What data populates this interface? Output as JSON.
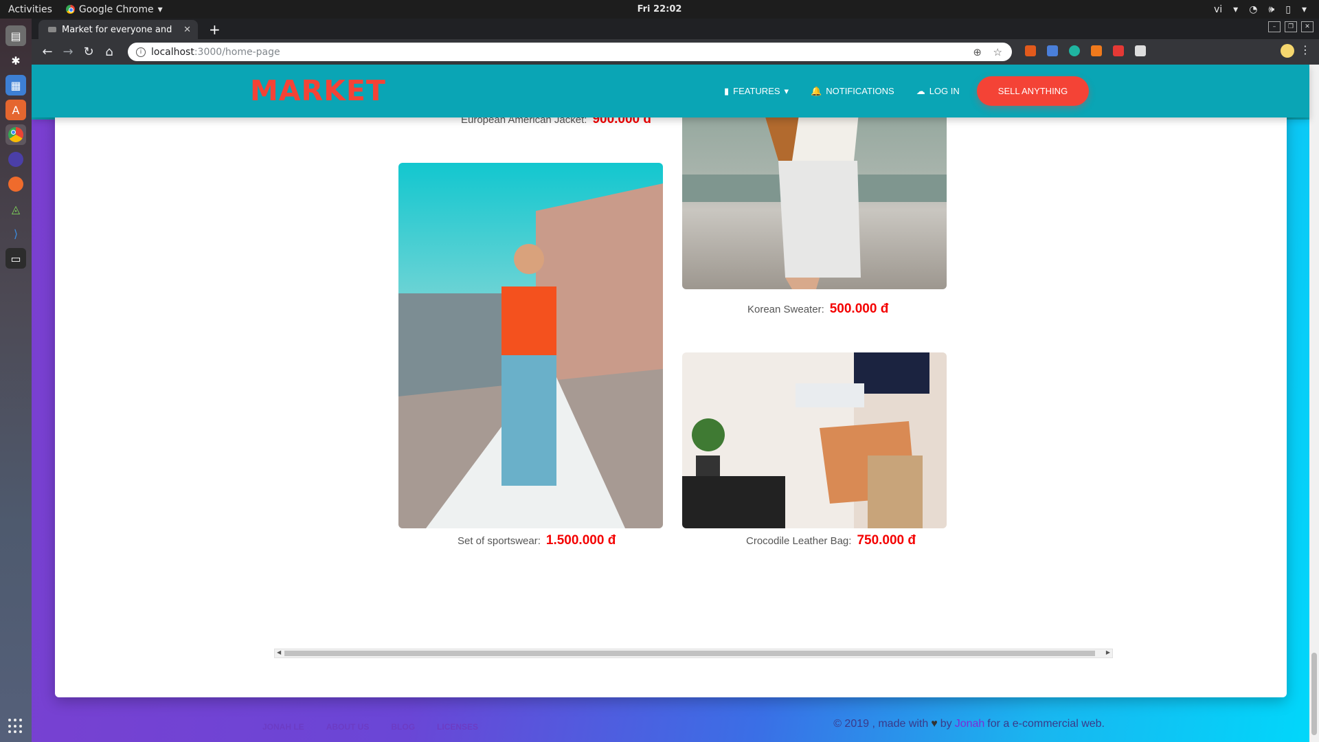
{
  "system": {
    "activities": "Activities",
    "app_menu": "Google Chrome",
    "clock": "Fri 22:02",
    "input_method": "vi"
  },
  "browser": {
    "tab_title": "Market for everyone and",
    "url_host": "localhost",
    "url_path": ":3000/home-page"
  },
  "site": {
    "brand": "MARKET",
    "brand_color": "#f44336",
    "nav": {
      "features": "FEATURES",
      "notifications": "NOTIFICATIONS",
      "login": "LOG IN",
      "sell": "SELL ANYTHING"
    },
    "products": [
      {
        "name": "European American Jacket:",
        "price": "900.000 đ"
      },
      {
        "name": "Korean Sweater:",
        "price": "500.000 đ"
      },
      {
        "name": "Set of sportswear:",
        "price": "1.500.000 đ"
      },
      {
        "name": "Crocodile Leather Bag:",
        "price": "750.000 đ"
      }
    ],
    "footer": {
      "links": [
        "JONAH LE",
        "ABOUT US",
        "BLOG",
        "LICENSES"
      ],
      "copy_prefix": "© 2019 , made with",
      "copy_by": "by",
      "author": "Jonah",
      "copy_suffix": "for a e-commercial web."
    }
  }
}
